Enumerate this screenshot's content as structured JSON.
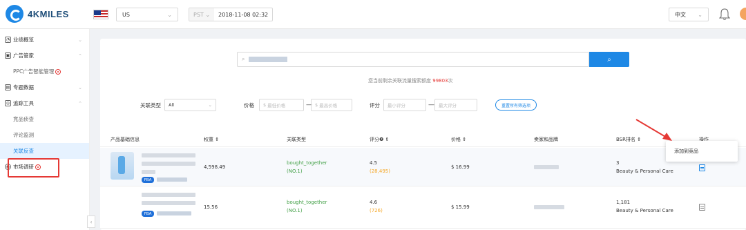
{
  "header": {
    "logo_text": "4KMILES",
    "marketplace": "US",
    "timezone": "PST",
    "datetime": "2018-11-08 02:32",
    "language": "中文"
  },
  "sidebar": {
    "items": [
      {
        "label": "业绩概览"
      },
      {
        "label": "广告管家"
      },
      {
        "label": "PPC广告智能管理"
      },
      {
        "label": "专题数据"
      },
      {
        "label": "追踪工具"
      },
      {
        "label": "竞品侦查"
      },
      {
        "label": "评论监测"
      },
      {
        "label": "关联反查"
      },
      {
        "label": "市场调研"
      }
    ],
    "collapse_glyph": "‹"
  },
  "search": {
    "quota_prefix": "您当前剩余关联流量搜索额度",
    "quota_value": "99803",
    "quota_suffix": "次"
  },
  "filters": {
    "assoc_type_label": "关联类型",
    "assoc_type_value": "All",
    "price_label": "价格",
    "price_min_placeholder": "最低价格",
    "price_max_placeholder": "最高价格",
    "rating_label": "评分",
    "rating_min_placeholder": "最小评分",
    "rating_max_placeholder": "最大评分",
    "clear_label": "重置所有筛选项",
    "dash": "—"
  },
  "table": {
    "headers": [
      "产品基础信息",
      "权重 ⇕",
      "关联类型",
      "评分❷ ⇕",
      "价格 ⇕",
      "卖家和品牌",
      "BSR排名 ⇕",
      "操作"
    ],
    "rows": [
      {
        "weight": "4,598.49",
        "assoc_type": "bought_together",
        "assoc_rank": "(NO.1)",
        "rating": "4.5",
        "reviews": "(28,495)",
        "price": "$ 16.99",
        "bsr_rank": "3",
        "bsr_category": "Beauty & Personal Care",
        "badge": "FBA"
      },
      {
        "weight": "15.56",
        "assoc_type": "bought_together",
        "assoc_rank": "(NO.1)",
        "rating": "4.6",
        "reviews": "(726)",
        "price": "$ 15.99",
        "bsr_rank": "1,181",
        "bsr_category": "Beauty & Personal Care",
        "badge": "FBA"
      }
    ]
  },
  "tooltip": {
    "label": "添加到竞品"
  },
  "colors": {
    "accent": "#1e88e5",
    "highlight": "#e53935",
    "positive": "#43a047",
    "reviews": "#f5a623"
  }
}
